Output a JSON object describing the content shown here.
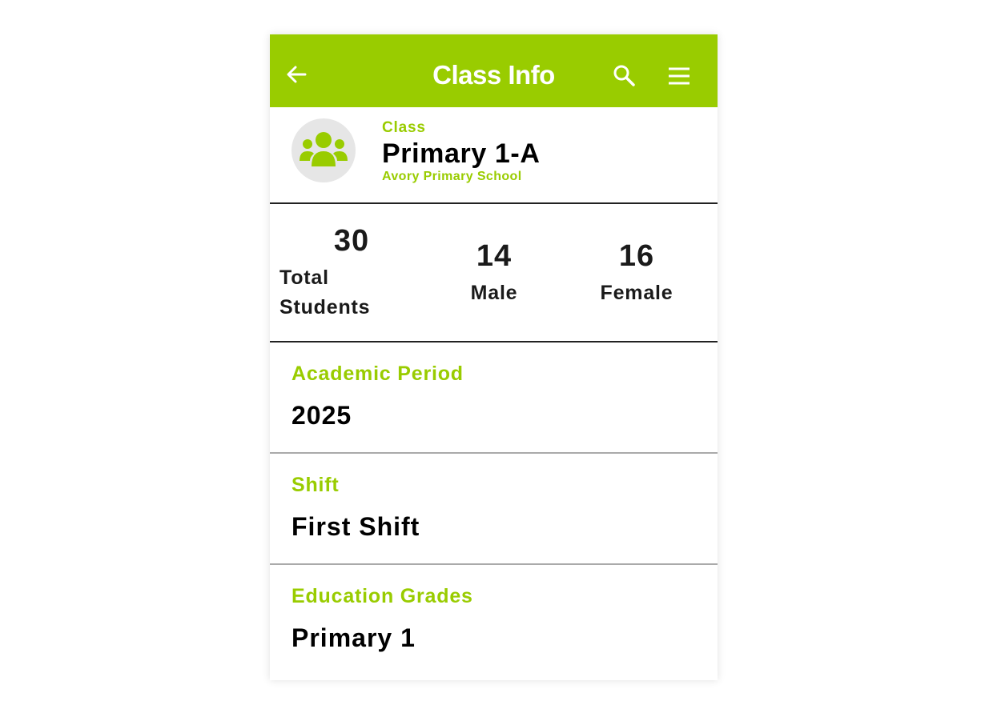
{
  "colors": {
    "accent": "#99cc00",
    "text": "#000000",
    "avatar_bg": "#e6e6e6"
  },
  "appbar": {
    "title": "Class Info",
    "back_icon": "arrow-left-icon",
    "search_icon": "search-icon",
    "menu_icon": "hamburger-menu-icon"
  },
  "class_header": {
    "avatar_icon": "group-users-icon",
    "label": "Class",
    "name": "Primary 1-A",
    "school": "Avory Primary School"
  },
  "stats": {
    "total": {
      "value": "30",
      "label_line1": "Total",
      "label_line2": "Students"
    },
    "male": {
      "value": "14",
      "label": "Male"
    },
    "female": {
      "value": "16",
      "label": "Female"
    }
  },
  "fields": [
    {
      "label": "Academic Period",
      "value": "2025"
    },
    {
      "label": "Shift",
      "value": "First Shift"
    },
    {
      "label": "Education Grades",
      "value": "Primary 1"
    }
  ]
}
